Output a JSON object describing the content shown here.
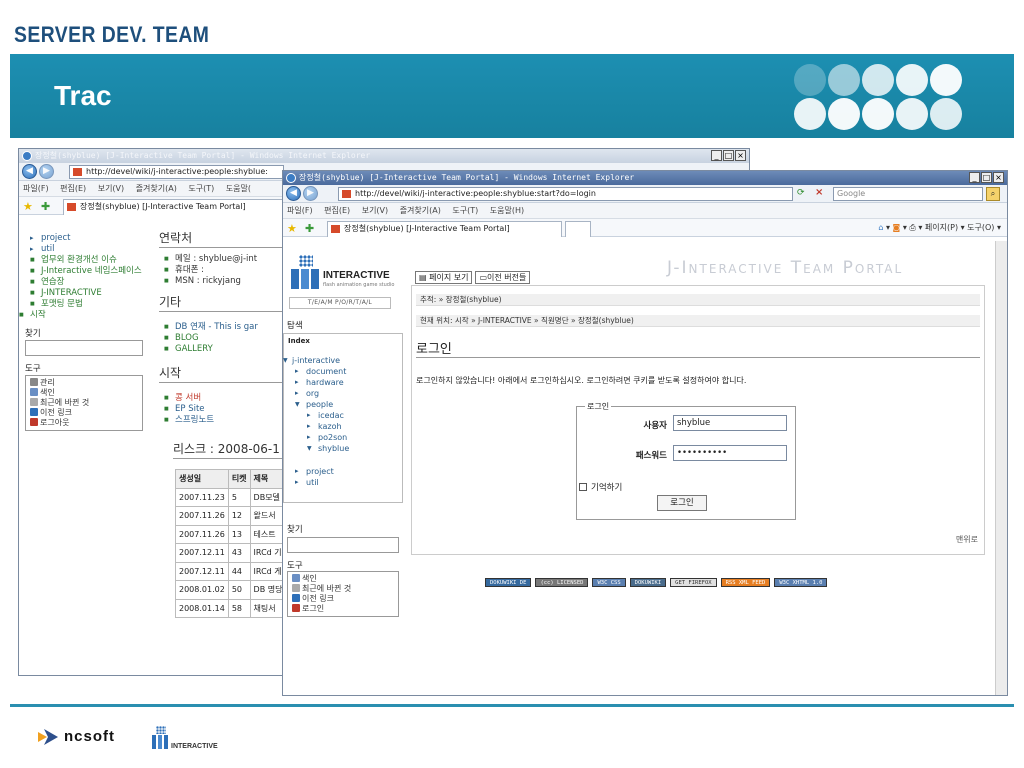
{
  "slide": {
    "team": "SERVER DEV. TEAM",
    "title": "Trac",
    "footer_logo_1": "ncsoft",
    "footer_logo_2": "INTERACTIVE",
    "accent": "#1d8fb2"
  },
  "back_window": {
    "title": "장정철(shyblue) [J-Interactive Team Portal] - Windows Internet Explorer",
    "address": "http://devel/wiki/j-interactive:people:shyblue:",
    "menu": [
      "파일(F)",
      "편집(E)",
      "보기(V)",
      "즐겨찾기(A)",
      "도구(T)",
      "도움말("
    ],
    "tab": "장정철(shyblue) [J-Interactive Team Portal]",
    "sidebar": {
      "tree": [
        "project",
        "util"
      ],
      "links": [
        "업무외 환경개선 이슈",
        "J-Interactive 네임스페이스",
        "연습장",
        "J-INTERACTIVE",
        "포맷팅 문법"
      ],
      "start": "시작",
      "search_label": "찾기",
      "tools_label": "도구",
      "tools": [
        "관리",
        "색인",
        "최근에 바뀐 것",
        "이전 링크",
        "로그아웃"
      ]
    },
    "main": {
      "contact_h": "연락처",
      "contact": [
        "메일 : shyblue@j-int",
        "휴대폰 :",
        "MSN : rickyjang"
      ],
      "etc_h": "기타",
      "etc": [
        "DB 연재 - This is gar",
        "BLOG",
        "GALLERY"
      ],
      "start_h": "시작",
      "start": [
        "콩 서버",
        "EP Site",
        "스프링노트"
      ],
      "risk_h": "리스크 : 2008-06-1",
      "table_headers": [
        "생성일",
        "티켓",
        "제목"
      ],
      "table_rows": [
        [
          "2007.11.23",
          "5",
          "DB모델"
        ],
        [
          "2007.11.26",
          "12",
          "왈드서"
        ],
        [
          "2007.11.26",
          "13",
          "테스트"
        ],
        [
          "2007.12.11",
          "43",
          "IRCd 기"
        ],
        [
          "2007.12.11",
          "44",
          "IRCd 게"
        ],
        [
          "2008.01.02",
          "50",
          "DB 명당"
        ],
        [
          "2008.01.14",
          "58",
          "채팅서"
        ]
      ]
    }
  },
  "front_window": {
    "title": "장정철(shyblue) [J-Interactive Team Portal] - Windows Internet Explorer",
    "address": "http://devel/wiki/j-interactive:people:shyblue:start?do=login",
    "search_placeholder": "Google",
    "menu": [
      "파일(F)",
      "편집(E)",
      "보기(V)",
      "즐겨찾기(A)",
      "도구(T)",
      "도움말(H)"
    ],
    "tab": "장정철(shyblue) [J-Interactive Team Portal]",
    "toolbar_right": "페이지(P) ▾  도구(O) ▾",
    "sidebar": {
      "logo": "INTERACTIVE",
      "logo_sub": "flash animation game studio",
      "team_portal": "T/E/A/M  P/O/R/T/A/L",
      "explore": "탐색",
      "index": "Index",
      "root": "j-interactive",
      "tree_top": [
        "document",
        "hardware",
        "org"
      ],
      "people": "people",
      "people_children": [
        "icedac",
        "kazoh",
        "po2son",
        "shyblue"
      ],
      "tree_bottom": [
        "project",
        "util"
      ],
      "search_label": "찾기",
      "tools_label": "도구",
      "tools": [
        "색인",
        "최근에 바뀐 것",
        "이전 링크",
        "로그인"
      ]
    },
    "main": {
      "btn_view": "페이지 보기",
      "btn_prev": "이전 버전들",
      "portal_title": "J-Interactive Team Portal",
      "trace": "추적: » 장정철(shyblue)",
      "location": "현재 위치: 시작 » J-INTERACTIVE » 직원명단 » 장정철(shyblue)",
      "login_h": "로그인",
      "login_msg": "로그인하지 않았습니다! 아래에서 로그인하십시오. 로그인하려면 쿠키를 받도록 설정하여야 합니다.",
      "legend": "로그인",
      "user_label": "사용자",
      "user_value": "shyblue",
      "pass_label": "패스워드",
      "pass_value": "••••••••••",
      "remember": "기억하기",
      "login_btn": "로그인",
      "top_link": "맨위로",
      "badges": [
        "DOKUWIKI DE",
        "(cc) LICENSED",
        "W3C CSS",
        "DOKUWIKI",
        "GET FIREFOX",
        "RSS XML FEED",
        "W3C XHTML 1.0"
      ]
    }
  }
}
